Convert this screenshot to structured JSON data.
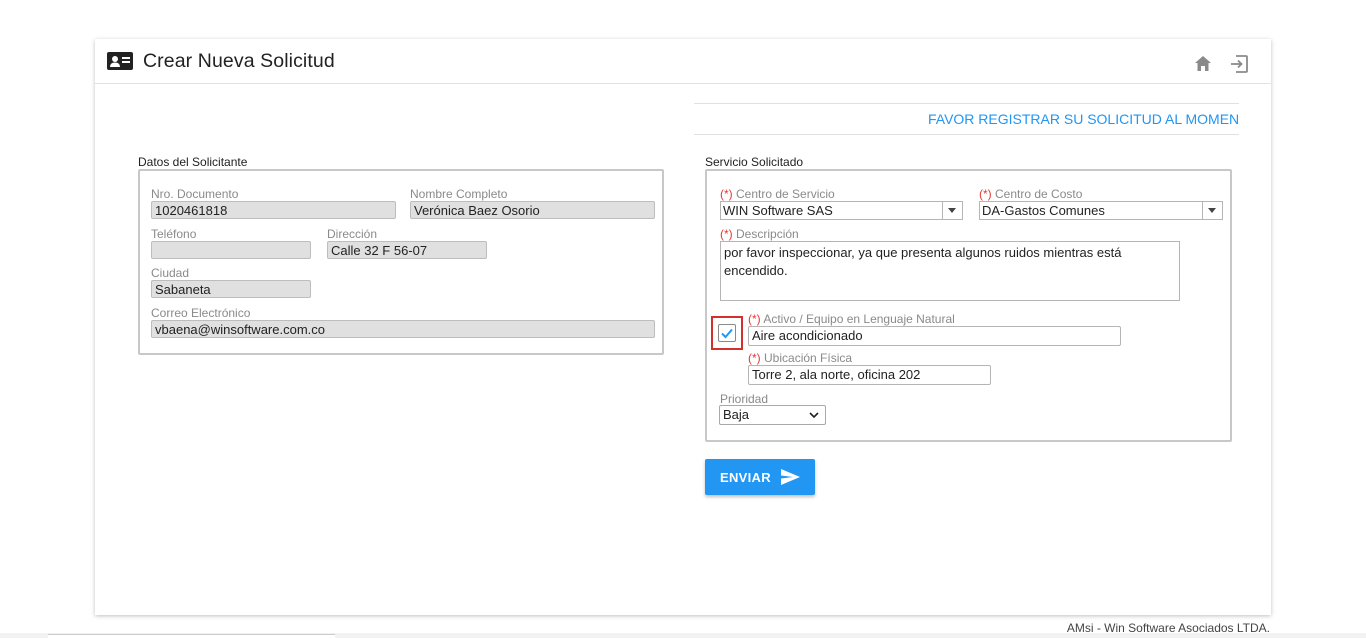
{
  "header": {
    "title": "Crear Nueva Solicitud",
    "icons": [
      "id-card-icon",
      "home-icon",
      "exit-icon"
    ]
  },
  "notice": "FAVOR REGISTRAR SU SOLICITUD AL MOMENTO (",
  "solicitante": {
    "legend": "Datos del Solicitante",
    "documento_label": "Nro. Documento",
    "documento": "1020461818",
    "nombre_label": "Nombre Completo",
    "nombre": "Verónica Baez Osorio",
    "telefono_label": "Teléfono",
    "telefono": "",
    "direccion_label": "Dirección",
    "direccion": "Calle 32 F 56-07",
    "ciudad_label": "Ciudad",
    "ciudad": "Sabaneta",
    "correo_label": "Correo Electrónico",
    "correo": "vbaena@winsoftware.com.co"
  },
  "servicio": {
    "legend": "Servicio Solicitado",
    "required_mark": "(*)",
    "centro_servicio_label": "Centro de Servicio",
    "centro_servicio": "WIN Software SAS",
    "centro_costo_label": "Centro de Costo",
    "centro_costo": "DA-Gastos Comunes",
    "descripcion_label": "Descripción",
    "descripcion": "por favor inspeccionar, ya que presenta algunos ruidos mientras está encendido.",
    "activo_checked": true,
    "activo_label": "Activo / Equipo en Lenguaje Natural",
    "activo": "Aire acondicionado",
    "ubicacion_label": "Ubicación Física",
    "ubicacion": "Torre 2, ala norte, oficina 202",
    "prioridad_label": "Prioridad",
    "prioridad": "Baja"
  },
  "send_button": "ENVIAR",
  "footer": "AMsi - Win Software Asociados LTDA.",
  "colors": {
    "accent": "#2196f3",
    "required": "#e53935",
    "highlight": "#d32f2f"
  }
}
